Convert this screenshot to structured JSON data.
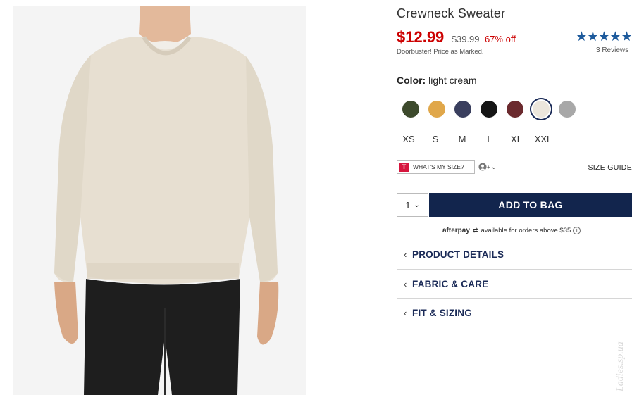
{
  "product": {
    "title": "Crewneck Sweater",
    "image_alt": "man wearing light cream crewneck sweater"
  },
  "pricing": {
    "sale": "$12.99",
    "original": "$39.99",
    "discount": "67% off",
    "note": "Doorbuster! Price as Marked."
  },
  "rating": {
    "stars": "★★★★★",
    "value": 5,
    "reviews": "3 Reviews"
  },
  "color": {
    "label": "Color:",
    "selected": "light cream",
    "swatches": [
      {
        "name": "olive",
        "hex": "#3d4a2c"
      },
      {
        "name": "gold",
        "hex": "#e0a74a"
      },
      {
        "name": "navy",
        "hex": "#3a3f5e"
      },
      {
        "name": "black",
        "hex": "#151515"
      },
      {
        "name": "burgundy",
        "hex": "#6b2a2e"
      },
      {
        "name": "light cream",
        "hex": "#ece6dc"
      },
      {
        "name": "heather grey",
        "hex": "#a8a8a8"
      }
    ]
  },
  "sizes": [
    "XS",
    "S",
    "M",
    "L",
    "XL",
    "XXL"
  ],
  "fit": {
    "whats_my_size": "WHAT'S MY SIZE?",
    "size_guide": "SIZE GUIDE",
    "logo_letter": "T"
  },
  "cart": {
    "quantity": "1",
    "add_label": "ADD TO BAG"
  },
  "afterpay": {
    "logo": "afterpay",
    "text": "available for orders above $35",
    "info": "i"
  },
  "accordions": [
    {
      "label": "PRODUCT DETAILS"
    },
    {
      "label": "FABRIC & CARE"
    },
    {
      "label": "FIT & SIZING"
    }
  ],
  "watermark": "Ladies.sp.ua",
  "colors": {
    "accent": "#12254d",
    "sale": "#cc0000",
    "stars": "#1d5a9c"
  }
}
